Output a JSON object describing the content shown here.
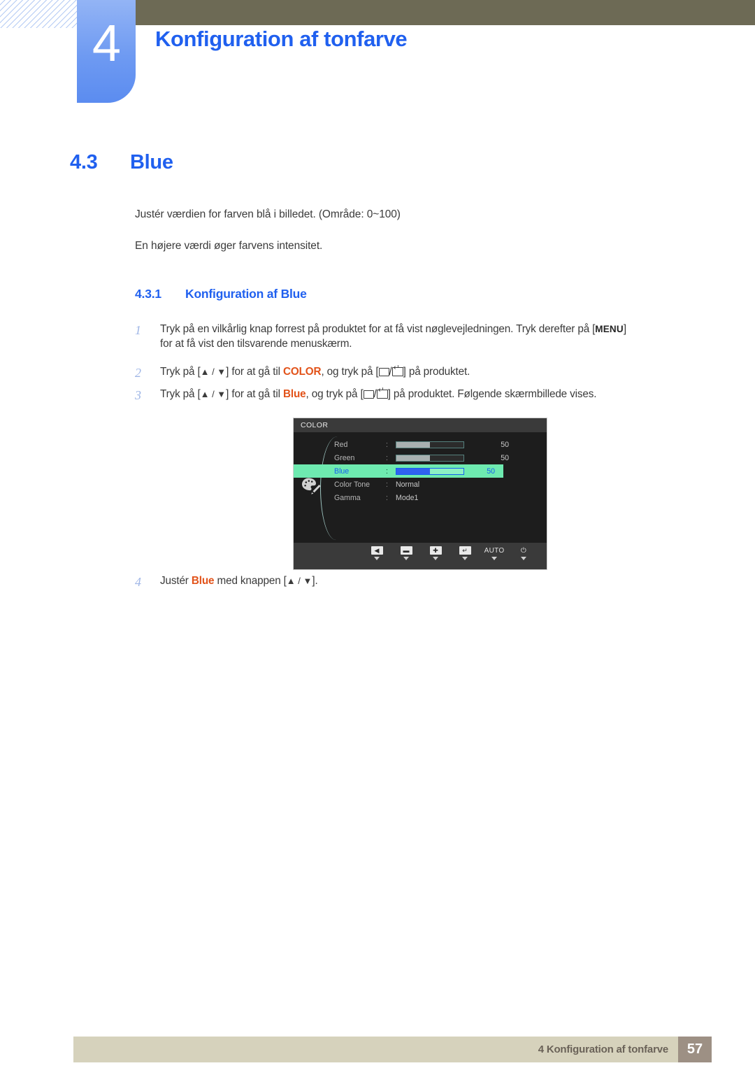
{
  "header": {
    "chapter_number": "4",
    "chapter_title": "Konfiguration af tonfarve"
  },
  "section": {
    "number": "4.3",
    "title": "Blue"
  },
  "intro": {
    "paragraph_1": "Justér værdien for farven blå i billedet. (Område: 0~100)",
    "paragraph_2": "En højere værdi øger farvens intensitet."
  },
  "subsection": {
    "number": "4.3.1",
    "title": "Konfiguration af Blue"
  },
  "steps": [
    {
      "number": "1",
      "text_before": "Tryk på en vilkårlig knap forrest på produktet for at få vist nøglevejledningen. Tryk derefter på [",
      "key": "MENU",
      "text_after": "]",
      "line2": "for at få vist den tilsvarende menuskærm."
    },
    {
      "number": "2",
      "part_1": "Tryk på [",
      "arrows": "▲ / ▼",
      "part_2": "] for at gå til ",
      "keyword": "COLOR",
      "part_3": ", og tryk på [",
      "part_4": "/",
      "part_5": "] på produktet."
    },
    {
      "number": "3",
      "part_1": "Tryk på [",
      "arrows": "▲ / ▼",
      "part_2": "] for at gå til ",
      "keyword": "Blue",
      "part_3": ", og tryk på [",
      "part_4": "/",
      "part_5": "] på produktet. Følgende skærmbillede vises."
    },
    {
      "number": "4",
      "part_1": "Justér ",
      "keyword": "Blue",
      "part_2": " med knappen [",
      "arrows": "▲ / ▼",
      "part_3": "]."
    }
  ],
  "osd": {
    "title": "COLOR",
    "icon": "palette-icon",
    "rows": [
      {
        "label": "Red",
        "type": "slider",
        "fill_percent": 50,
        "value": "50",
        "selected": false
      },
      {
        "label": "Green",
        "type": "slider",
        "fill_percent": 50,
        "value": "50",
        "selected": false
      },
      {
        "label": "Blue",
        "type": "slider",
        "fill_percent": 50,
        "value": "50",
        "selected": true
      },
      {
        "label": "Color Tone",
        "type": "text",
        "value": "Normal",
        "selected": false
      },
      {
        "label": "Gamma",
        "type": "text",
        "value": "Mode1",
        "selected": false
      }
    ],
    "keys": [
      {
        "name": "back-key",
        "glyph": "◀",
        "type": "icon"
      },
      {
        "name": "minus-key",
        "glyph": "▬",
        "type": "icon"
      },
      {
        "name": "plus-key",
        "glyph": "✚",
        "type": "icon"
      },
      {
        "name": "enter-key",
        "glyph": "↵",
        "type": "icon"
      },
      {
        "name": "auto-key",
        "glyph": "AUTO",
        "type": "text"
      },
      {
        "name": "power-key",
        "glyph": "⏻",
        "type": "text"
      }
    ]
  },
  "footer": {
    "text": "4 Konfiguration af tonfarve",
    "page_number": "57"
  },
  "colors": {
    "accent_blue": "#2060ef",
    "keyword_orange": "#e2531a",
    "olive_band": "#6d6a55",
    "tab_blue": "#6e9af2",
    "footer_beige": "#d6d2bc",
    "footer_page_taupe": "#9d9084",
    "osd_highlight_green": "#6eeab0",
    "osd_background": "#1d1d1d"
  }
}
